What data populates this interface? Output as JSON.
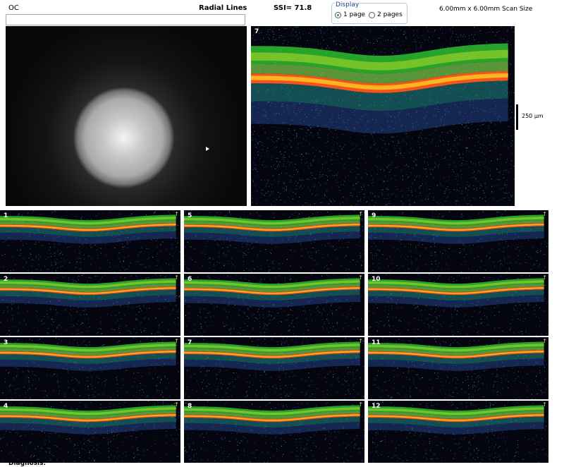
{
  "header": {
    "eye": "OC",
    "scan_pattern": "Radial Lines",
    "ssi": "SSI= 71.8",
    "scan_size": "6.00mm x 6.00mm Scan Size"
  },
  "display": {
    "title": "Display",
    "options": [
      "1 page",
      "2 pages"
    ],
    "selected": "1 page"
  },
  "main_scan": {
    "number": "7",
    "scale_label": "250 µm"
  },
  "thumbnails": [
    {
      "number": "1"
    },
    {
      "number": "5"
    },
    {
      "number": "9"
    },
    {
      "number": "2"
    },
    {
      "number": "6"
    },
    {
      "number": "10"
    },
    {
      "number": "3"
    },
    {
      "number": "7"
    },
    {
      "number": "11"
    },
    {
      "number": "4"
    },
    {
      "number": "8"
    },
    {
      "number": "12"
    }
  ],
  "footer": {
    "diagnosis_label": "Diagnosis:"
  },
  "colors": {
    "background": "#050510",
    "nfl": "#2fbf2f",
    "rpe": "#ff5a1e",
    "rpe_core": "#ffcc22",
    "choroid": "#3366cc"
  }
}
